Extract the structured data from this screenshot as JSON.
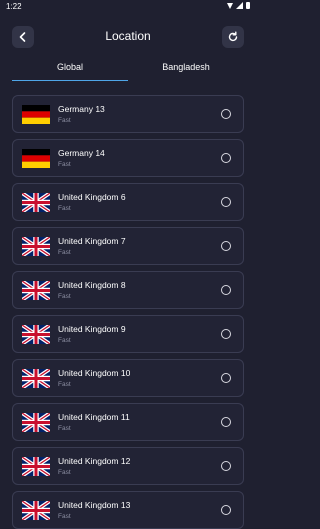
{
  "status": {
    "time": "1:22"
  },
  "header": {
    "title": "Location",
    "back_icon": "chevron-left-icon",
    "refresh_icon": "refresh-icon"
  },
  "tabs": [
    {
      "label": "Global",
      "active": true
    },
    {
      "label": "Bangladesh",
      "active": false
    }
  ],
  "accent": "#4fa6e8",
  "servers": [
    {
      "name": "Germany 13",
      "speed": "Fast",
      "flag": "germany"
    },
    {
      "name": "Germany 14",
      "speed": "Fast",
      "flag": "germany"
    },
    {
      "name": "United Kingdom 6",
      "speed": "Fast",
      "flag": "uk"
    },
    {
      "name": "United Kingdom 7",
      "speed": "Fast",
      "flag": "uk"
    },
    {
      "name": "United Kingdom 8",
      "speed": "Fast",
      "flag": "uk"
    },
    {
      "name": "United Kingdom 9",
      "speed": "Fast",
      "flag": "uk"
    },
    {
      "name": "United Kingdom 10",
      "speed": "Fast",
      "flag": "uk"
    },
    {
      "name": "United Kingdom 11",
      "speed": "Fast",
      "flag": "uk"
    },
    {
      "name": "United Kingdom 12",
      "speed": "Fast",
      "flag": "uk"
    },
    {
      "name": "United Kingdom 13",
      "speed": "Fast",
      "flag": "uk"
    }
  ]
}
